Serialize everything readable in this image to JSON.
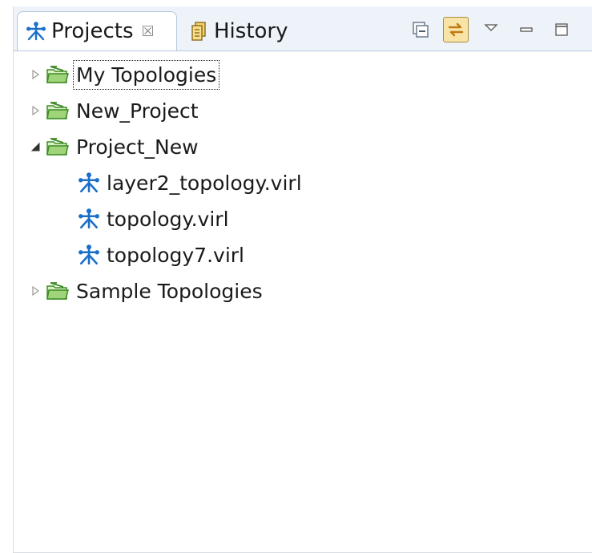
{
  "tabs": {
    "projects": {
      "label": "Projects",
      "icon": "topology-icon",
      "close": "☒"
    },
    "history": {
      "label": "History",
      "icon": "history-icon"
    }
  },
  "toolbar": {
    "buttons": [
      "collapse-all-icon",
      "link-with-editor-icon",
      "view-menu-icon",
      "minimize-icon",
      "maximize-icon"
    ],
    "link_with_editor_pressed": true
  },
  "tree": {
    "items": [
      {
        "label": "My Topologies",
        "expanded": false,
        "icon": "project-folder-icon"
      },
      {
        "label": "New_Project",
        "expanded": false,
        "icon": "project-folder-icon"
      },
      {
        "label": "Project_New",
        "expanded": true,
        "icon": "project-folder-icon",
        "children": [
          {
            "label": "layer2_topology.virl",
            "icon": "topology-file-icon"
          },
          {
            "label": "topology.virl",
            "icon": "topology-file-icon"
          },
          {
            "label": "topology7.virl",
            "icon": "topology-file-icon"
          }
        ]
      },
      {
        "label": "Sample Topologies",
        "expanded": false,
        "icon": "project-folder-icon"
      }
    ]
  },
  "colors": {
    "tab_bar": "#eef3fa",
    "topology_blue": "#1a6fc9",
    "folder_green": "#4aa02c",
    "pressed_button": "#f9e4a8"
  }
}
